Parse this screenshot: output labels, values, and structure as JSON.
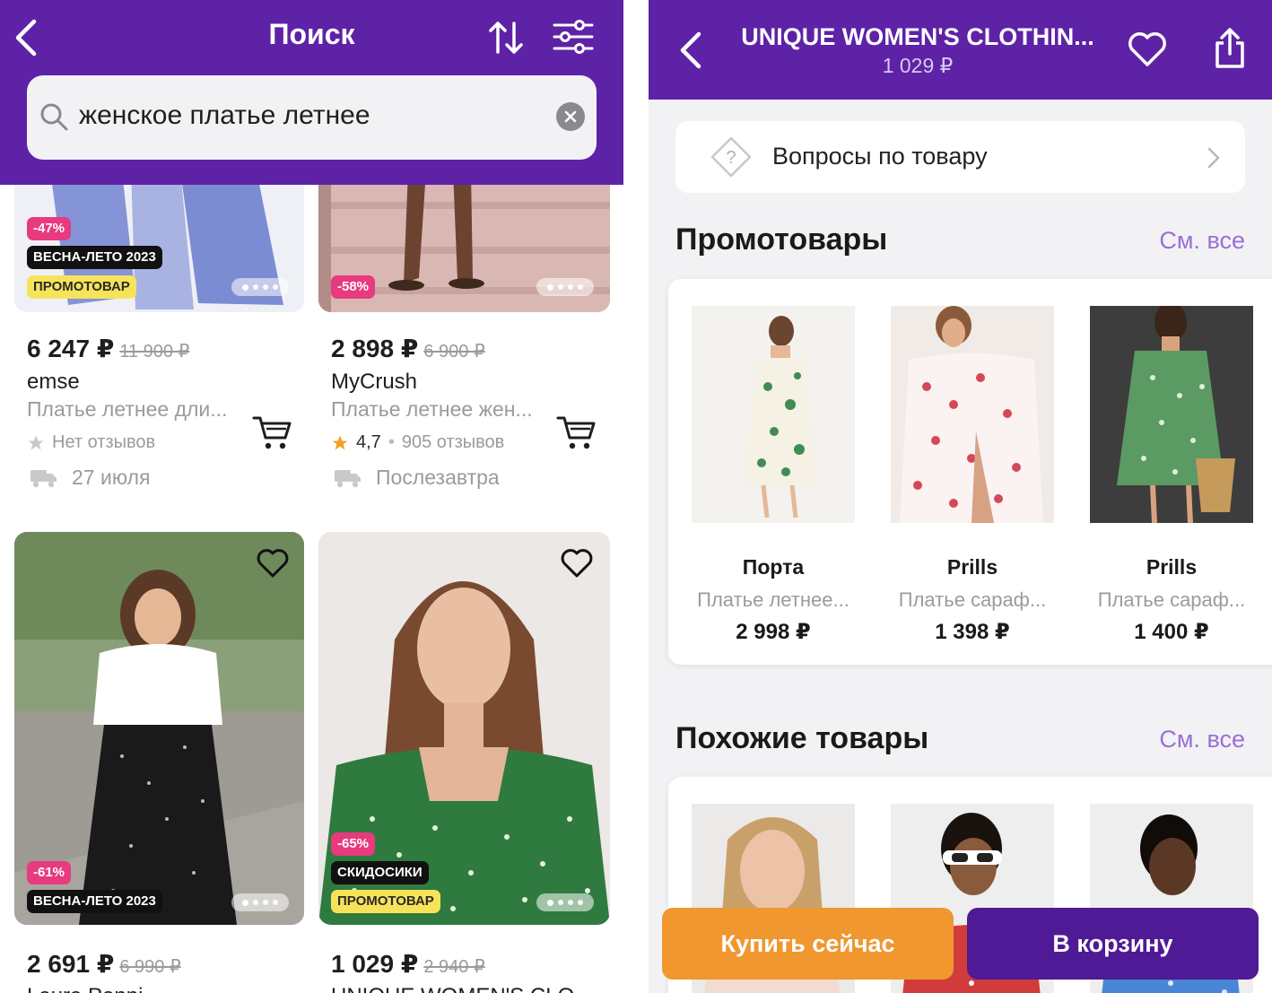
{
  "left": {
    "header": {
      "title": "Поиск"
    },
    "search": {
      "value": "женское платье летнее"
    },
    "products": [
      {
        "discount": "-47%",
        "season": "ВЕСНА-ЛЕТО 2023",
        "promo": "ПРОМОТОВАР",
        "price": "6 247 ₽",
        "old_price": "11 900 ₽",
        "brand": "emse",
        "name": "Платье летнее дли...",
        "rating": "Нет отзывов",
        "delivery": "27 июля"
      },
      {
        "discount": "-58%",
        "price": "2 898 ₽",
        "old_price": "6 900 ₽",
        "brand": "MyCrush",
        "name": "Платье летнее жен...",
        "rating_value": "4,7",
        "rating": "905 отзывов",
        "delivery": "Послезавтра"
      },
      {
        "discount": "-61%",
        "season": "ВЕСНА-ЛЕТО 2023",
        "price": "2 691 ₽",
        "old_price": "6 990 ₽",
        "brand": "Laura Ponni"
      },
      {
        "discount": "-65%",
        "sale": "СКИДОСИКИ",
        "promo": "ПРОМОТОВАР",
        "price": "1 029 ₽",
        "old_price": "2 940 ₽",
        "brand": "UNIQUE WOMEN'S CLO"
      }
    ]
  },
  "right": {
    "header": {
      "title": "UNIQUE WOMEN'S CLOTHIN...",
      "price": "1 029 ₽"
    },
    "questions": {
      "label": "Вопросы по товару"
    },
    "promo_section": {
      "title": "Промотовары",
      "see_all": "См. все",
      "items": [
        {
          "brand": "Порта",
          "name": "Платье летнее...",
          "price": "2 998 ₽"
        },
        {
          "brand": "Prills",
          "name": "Платье сараф...",
          "price": "1 398 ₽"
        },
        {
          "brand": "Prills",
          "name": "Платье сараф...",
          "price": "1 400 ₽"
        }
      ]
    },
    "similar_section": {
      "title": "Похожие товары",
      "see_all": "См. все"
    },
    "buttons": {
      "buy_now": "Купить сейчас",
      "to_cart": "В корзину"
    }
  },
  "colors": {
    "brand_purple": "#5e22a6",
    "buy_orange": "#f0972f",
    "cart_purple": "#4f1a95",
    "link": "#9b6fd8",
    "discount": "#e83a7e",
    "promo": "#f7e35a"
  }
}
